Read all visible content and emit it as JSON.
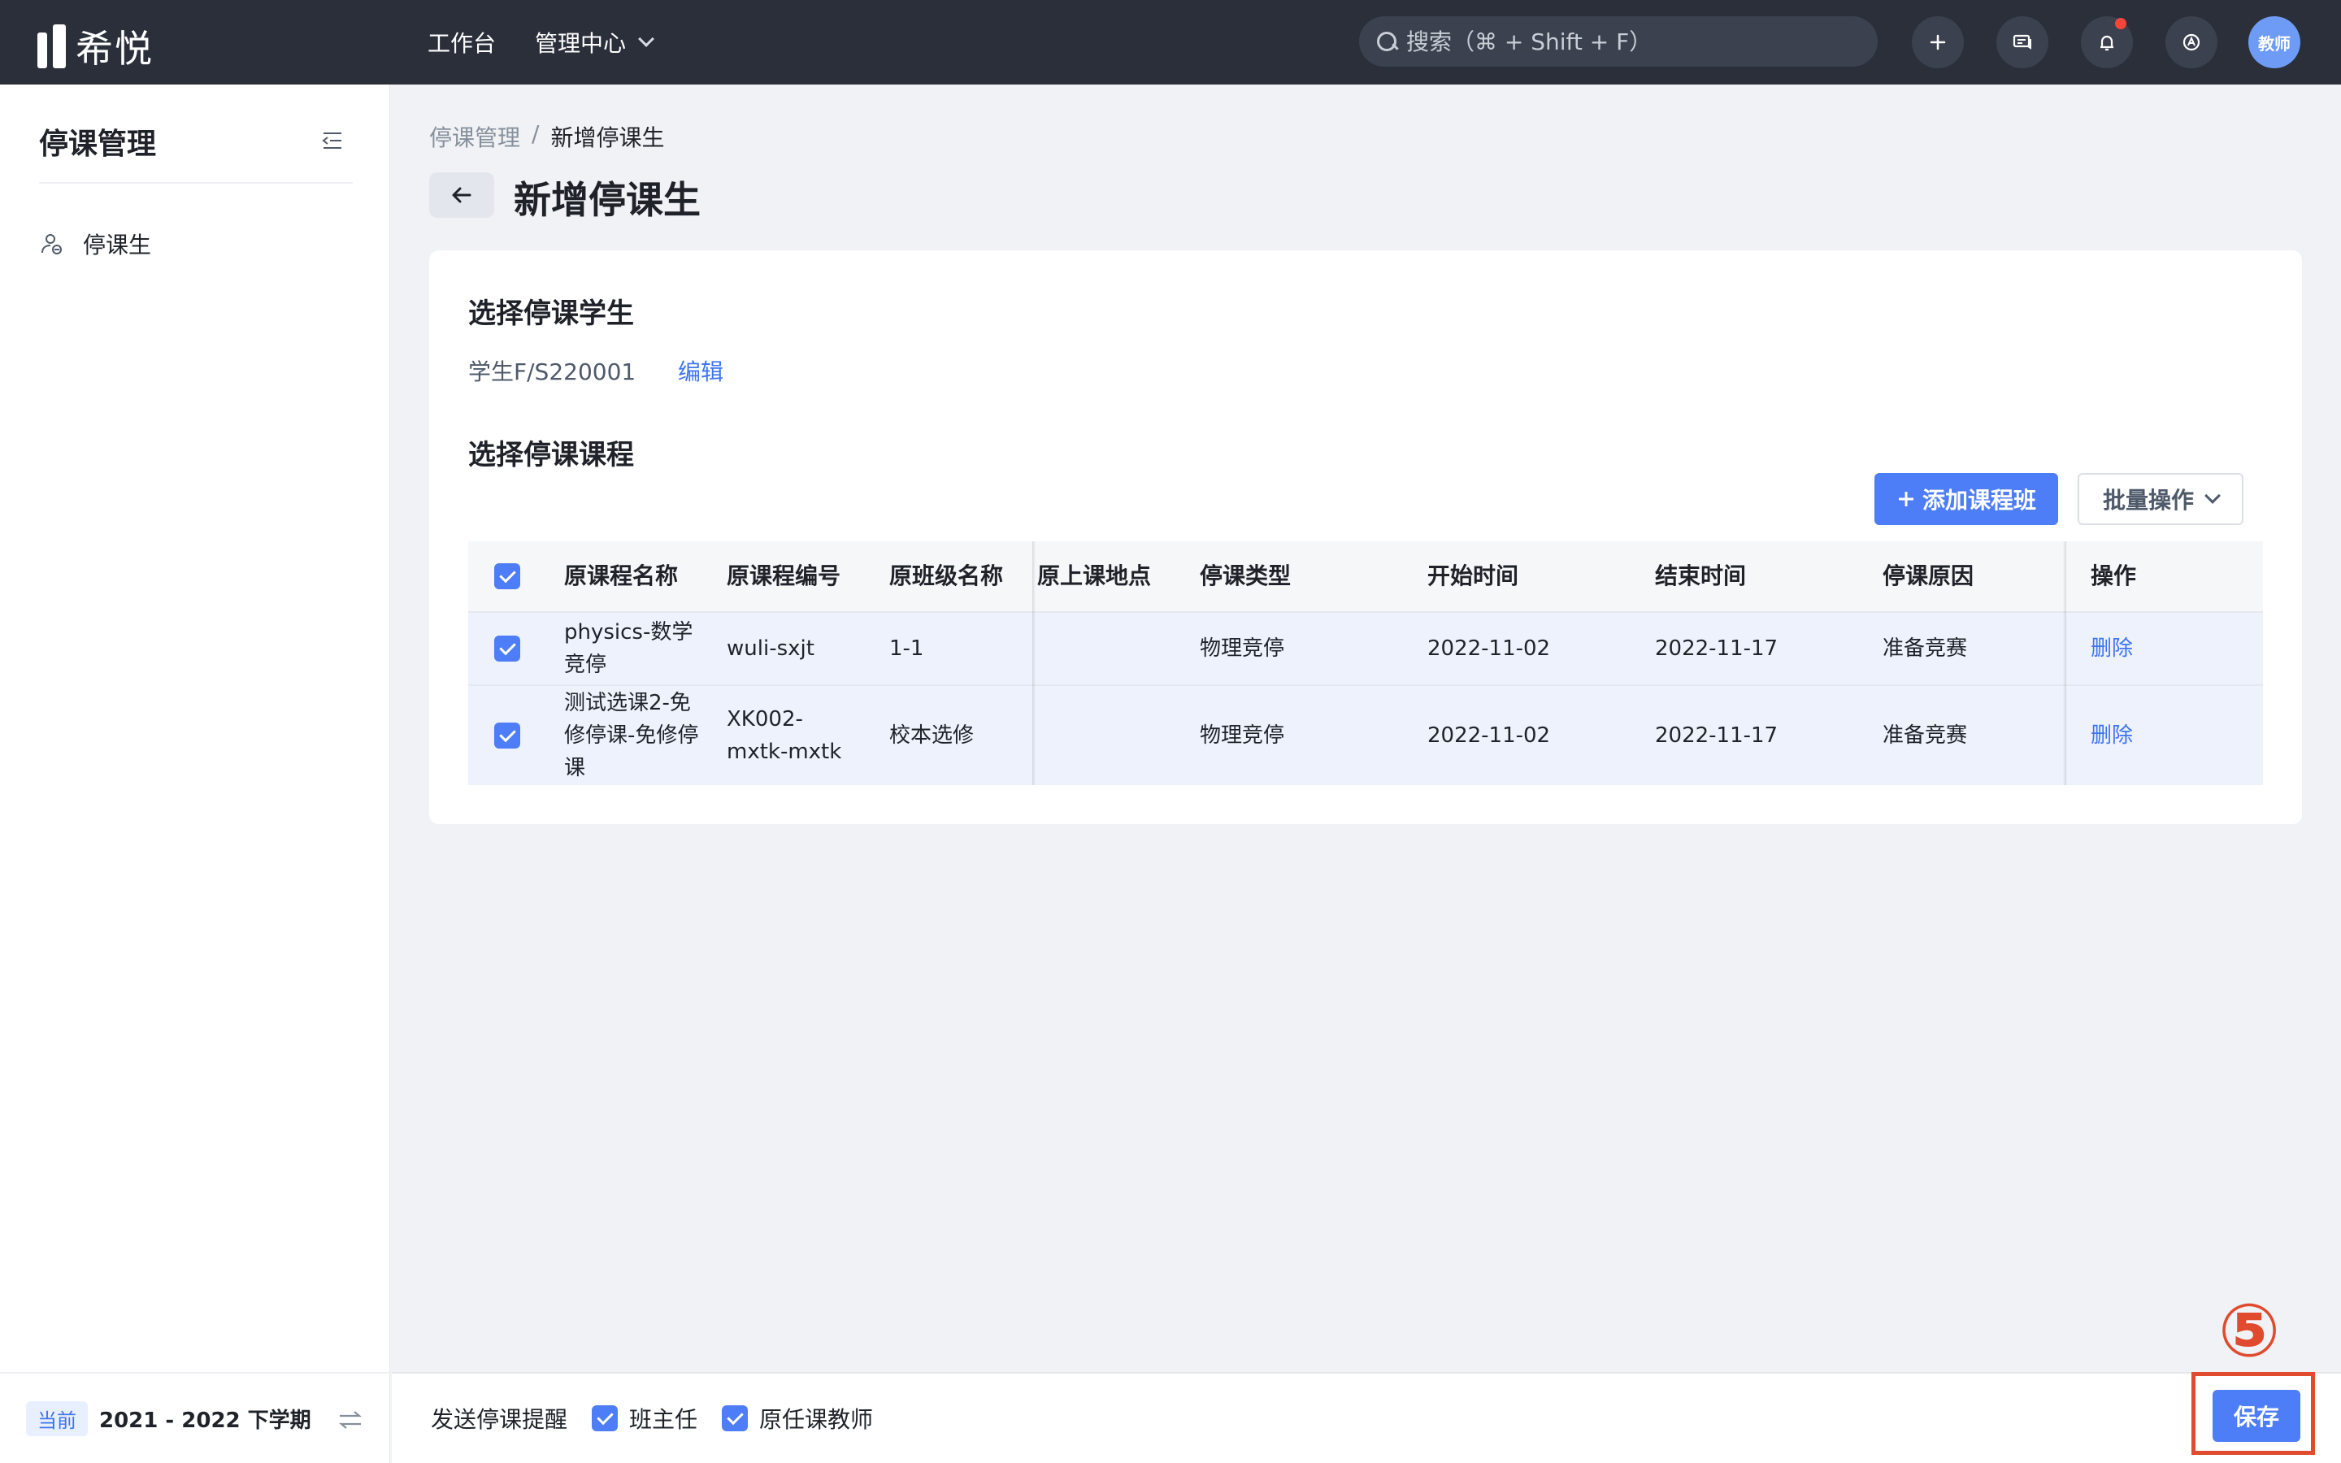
{
  "header": {
    "logo_text": "希悦",
    "nav": [
      {
        "label": "工作台"
      },
      {
        "label": "管理中心"
      }
    ],
    "search_placeholder": "搜索（⌘ + Shift + F）",
    "avatar_text": "教师"
  },
  "sidebar": {
    "title": "停课管理",
    "items": [
      {
        "label": "停课生",
        "icon": "user-icon"
      }
    ],
    "term_badge": "当前",
    "term_text": "2021 - 2022 下学期"
  },
  "breadcrumb": {
    "parent": "停课管理",
    "separator": "/",
    "current": "新增停课生"
  },
  "page_title": "新增停课生",
  "student_section": {
    "title": "选择停课学生",
    "student": "学生F/S220001",
    "edit_label": "编辑"
  },
  "course_section": {
    "title": "选择停课课程",
    "add_button": "添加课程班",
    "batch_button": "批量操作",
    "columns": [
      "原课程名称",
      "原课程编号",
      "原班级名称",
      "原上课地点",
      "停课类型",
      "开始时间",
      "结束时间",
      "停课原因",
      "操作"
    ],
    "rows": [
      {
        "name": "physics-数学竞停",
        "code": "wuli-sxjt",
        "class": "1-1",
        "location": "",
        "type": "物理竞停",
        "start": "2022-11-02",
        "end": "2022-11-17",
        "reason": "准备竞赛",
        "action": "删除",
        "checked": true
      },
      {
        "name": "测试选课2-免修停课-免修停课",
        "code": "XK002-mxtk-mxtk",
        "class": "校本选修",
        "location": "",
        "type": "物理竞停",
        "start": "2022-11-02",
        "end": "2022-11-17",
        "reason": "准备竞赛",
        "action": "删除",
        "checked": true
      }
    ]
  },
  "footer": {
    "notify_label": "发送停课提醒",
    "options": [
      {
        "label": "班主任",
        "checked": true
      },
      {
        "label": "原任课教师",
        "checked": true
      }
    ],
    "save_label": "保存"
  },
  "annotation": {
    "number": "⑤",
    "color": "#e04a2e"
  },
  "colors": {
    "primary": "#4d7ef7",
    "topbar": "#2a2f3a",
    "link": "#3f74f0"
  }
}
